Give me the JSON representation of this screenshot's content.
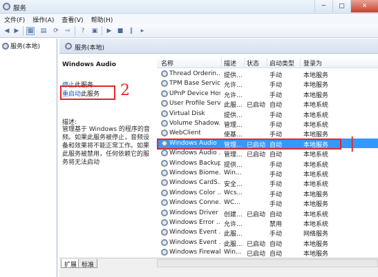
{
  "window": {
    "title": "服务",
    "controls": [
      "─",
      "□",
      "✕"
    ]
  },
  "menu": [
    "文件(F)",
    "操作(A)",
    "查看(V)",
    "帮助(H)"
  ],
  "toolbar": {
    "icons": [
      {
        "name": "back-icon",
        "glyph": "◀"
      },
      {
        "name": "forward-icon",
        "glyph": "▶"
      },
      {
        "name": "console-tree-icon",
        "glyph": "▦"
      },
      {
        "name": "refresh-view-icon",
        "glyph": "▤"
      },
      {
        "name": "refresh-icon",
        "glyph": "⟳"
      },
      {
        "name": "export-icon",
        "glyph": "⇨"
      },
      {
        "name": "help-icon",
        "glyph": "?"
      },
      {
        "name": "properties-icon",
        "glyph": "▣"
      },
      {
        "name": "start-icon",
        "glyph": "▶"
      },
      {
        "name": "stop-icon",
        "glyph": "■"
      },
      {
        "name": "pause-icon",
        "glyph": "‖"
      },
      {
        "name": "restart-icon",
        "glyph": "▸"
      }
    ]
  },
  "tree": {
    "root_label": "服务(本地)"
  },
  "main_header": "服务(本地)",
  "detail": {
    "service_name": "Windows Audio",
    "stop_link": "停止",
    "stop_suffix": "此服务",
    "restart_link": "重启动",
    "restart_suffix": "此服务",
    "desc_label": "描述:",
    "description": "管理基于 Windows 的程序的音频。如果此服务被停止，音频设备和效果将不能正常工作。如果此服务被禁用，任何依赖它的服务将无法启动",
    "annotation": "2"
  },
  "columns": [
    "名称",
    "描述",
    "状态",
    "启动类型",
    "登录为"
  ],
  "rows": [
    [
      "Thread Orderin...",
      "提供...",
      "",
      "手动",
      "本地服务"
    ],
    [
      "TPM Base Servic...",
      "允许...",
      "",
      "手动",
      "本地服务"
    ],
    [
      "UPnP Device Host",
      "允许...",
      "",
      "手动",
      "本地服务"
    ],
    [
      "User Profile Serv...",
      "此服...",
      "已启动",
      "自动",
      "本地系统"
    ],
    [
      "Virtual Disk",
      "提供...",
      "",
      "手动",
      "本地系统"
    ],
    [
      "Volume Shadow...",
      "管理...",
      "",
      "手动",
      "本地系统"
    ],
    [
      "WebClient",
      "使基...",
      "",
      "手动",
      "本地服务"
    ],
    [
      "Windows Audio",
      "管理...",
      "已启动",
      "自动",
      "本地服务"
    ],
    [
      "Windows Audio ...",
      "管理...",
      "已启动",
      "自动",
      "本地系统"
    ],
    [
      "Windows Backup",
      "提供...",
      "",
      "手动",
      "本地系统"
    ],
    [
      "Windows Biome...",
      "Win...",
      "",
      "手动",
      "本地系统"
    ],
    [
      "Windows CardS...",
      "安全...",
      "",
      "手动",
      "本地系统"
    ],
    [
      "Windows Color ...",
      "Wcs...",
      "",
      "手动",
      "本地服务"
    ],
    [
      "Windows Conne...",
      "WC...",
      "",
      "手动",
      "本地服务"
    ],
    [
      "Windows Driver ...",
      "创建...",
      "已启动",
      "自动",
      "本地系统"
    ],
    [
      "Windows Error ...",
      "允许...",
      "",
      "禁用",
      "本地系统"
    ],
    [
      "Windows Event ...",
      "此服...",
      "",
      "手动",
      "网络服务"
    ],
    [
      "Windows Event ...",
      "此服...",
      "已启动",
      "自动",
      "本地服务"
    ],
    [
      "Windows Firewall",
      "Win...",
      "已启动",
      "自动",
      "本地服务"
    ]
  ],
  "selected_row": 7,
  "row_annotation": "|",
  "tabs": [
    "扩展",
    "标准"
  ],
  "colors": {
    "selection": "#3399ff",
    "annotation": "#e52525",
    "link": "#1a55c8"
  }
}
